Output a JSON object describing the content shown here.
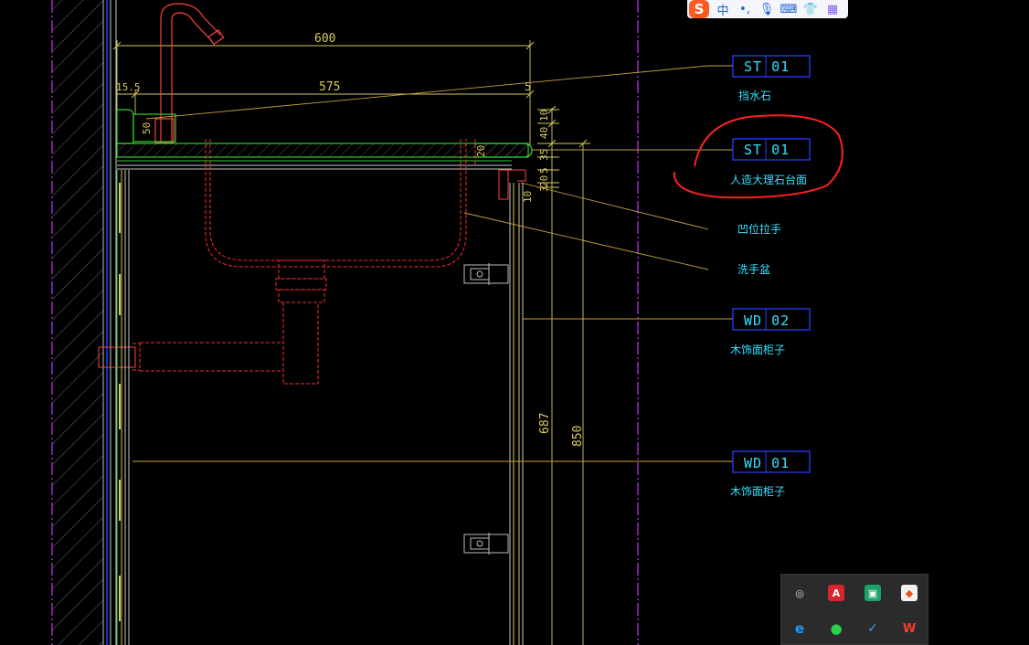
{
  "dimensions": {
    "d600": "600",
    "d575": "575",
    "d15_5": "15.5",
    "d5": "5",
    "d50": "50",
    "d20": "20",
    "d10a": "10",
    "d40": "40",
    "d35": "35",
    "d5b": "5",
    "d20b": "20",
    "d3": "3",
    "d10b": "10",
    "d687": "687",
    "d850": "850"
  },
  "callouts": [
    {
      "code": "ST 01",
      "desc": "挡水石"
    },
    {
      "code": "ST 01",
      "desc": "人造大理石台面"
    },
    {
      "code": "",
      "desc": "凹位拉手"
    },
    {
      "code": "",
      "desc": "洗手盆"
    },
    {
      "code": "WD 02",
      "desc": "木饰面柜子"
    },
    {
      "code": "WD 01",
      "desc": "木饰面柜子"
    }
  ],
  "ime_toolbar": {
    "logo": "S",
    "lang": "中",
    "icons": [
      "punctuation-icon",
      "microphone-icon",
      "keyboard-icon",
      "skin-icon",
      "toolbox-icon"
    ]
  },
  "tray": {
    "icons": [
      {
        "name": "network-icon",
        "glyph": "◎",
        "color": "#3a3a3a"
      },
      {
        "name": "adobe-reader-icon",
        "glyph": "A",
        "color": "#d8262c"
      },
      {
        "name": "remote-desktop-icon",
        "glyph": "▣",
        "color": "#1aa36b"
      },
      {
        "name": "cloud-sync-icon",
        "glyph": "◆",
        "color": "#f2f2f2"
      },
      {
        "name": "browser-icon",
        "glyph": "e",
        "color": "#1e7bd6"
      },
      {
        "name": "wechat-icon",
        "glyph": "●",
        "color": "#2bae3a"
      },
      {
        "name": "security-shield-icon",
        "glyph": "✓",
        "color": "#1e7bd6"
      },
      {
        "name": "wps-icon",
        "glyph": "W",
        "color": "#e23b2e"
      }
    ]
  },
  "colors": {
    "background": "#000000",
    "dim": "#d8c860",
    "red": "#ff2a2a",
    "green": "#33cc33",
    "cyan": "#33e0ff",
    "blue": "#2a3cff",
    "magenta": "#c833ff",
    "leader": "#c8a040",
    "annotation_circle": "#ff2020"
  }
}
